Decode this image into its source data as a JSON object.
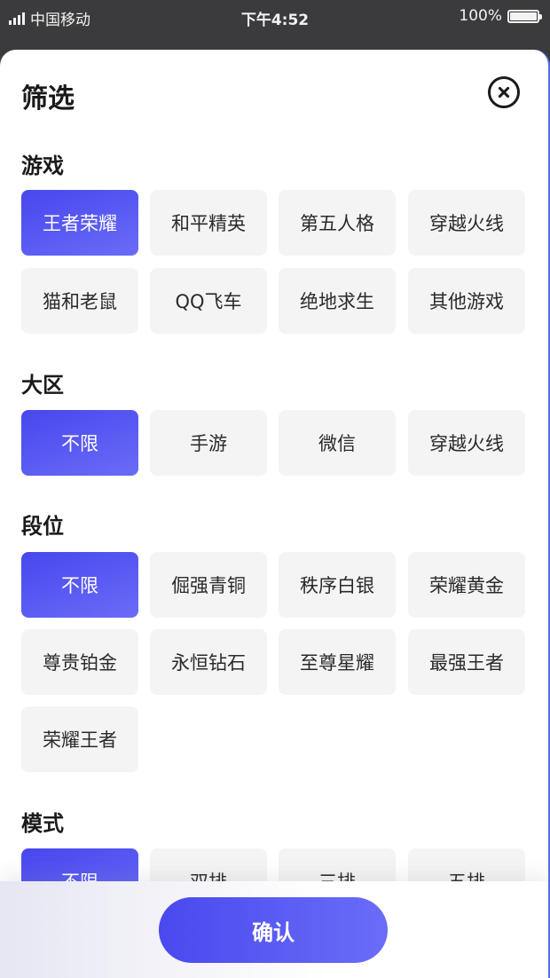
{
  "status_bar": {
    "carrier": "中国移动",
    "time": "下午4:52",
    "battery": "100%",
    "battery_level": 1.0
  },
  "sheet": {
    "title": "筛选",
    "close_icon": "close-circle-icon"
  },
  "sections": {
    "game": {
      "title": "游戏",
      "options": [
        "王者荣耀",
        "和平精英",
        "第五人格",
        "穿越火线",
        "猫和老鼠",
        "QQ飞车",
        "绝地求生",
        "其他游戏"
      ],
      "selected": "王者荣耀"
    },
    "region": {
      "title": "大区",
      "options": [
        "不限",
        "手游",
        "微信",
        "穿越火线"
      ],
      "selected": "不限"
    },
    "rank": {
      "title": "段位",
      "options": [
        "不限",
        "倔强青铜",
        "秩序白银",
        "荣耀黄金",
        "尊贵铂金",
        "永恒钻石",
        "至尊星耀",
        "最强王者",
        "荣耀王者"
      ],
      "selected": "不限"
    },
    "mode": {
      "title": "模式",
      "options": [
        "不限",
        "双排",
        "三排",
        "五排"
      ],
      "selected": "不限"
    }
  },
  "footer": {
    "confirm_label": "确认"
  },
  "colors": {
    "accent": "#4a4aee",
    "chip_bg": "#f4f4f4",
    "text": "#1a1a1a"
  }
}
